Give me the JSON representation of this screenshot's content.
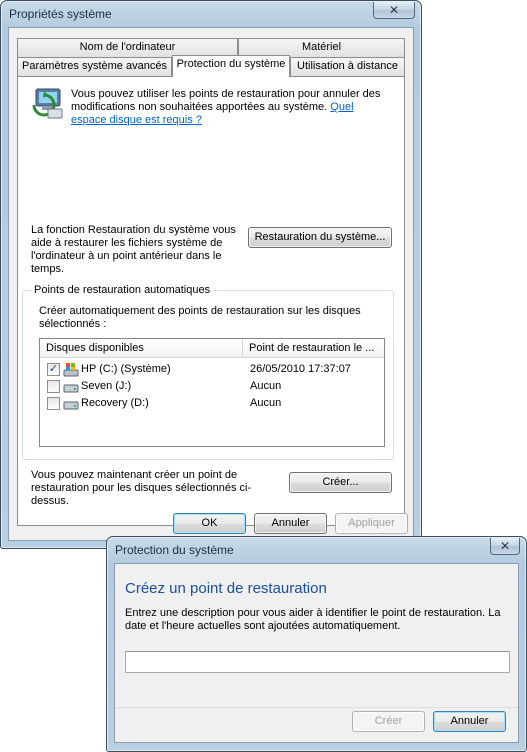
{
  "main_window": {
    "title": "Propriétés système",
    "close_glyph": "✕",
    "tabs_row1": [
      "Nom de l'ordinateur",
      "Matériel"
    ],
    "tabs_row2": [
      "Paramètres système avancés",
      "Protection du système",
      "Utilisation à distance"
    ],
    "intro_text": "Vous pouvez utiliser les points de restauration pour annuler des modifications non souhaitées apportées au système.",
    "intro_link": "Quel espace disque est requis ?",
    "restore_text": "La fonction Restauration du système vous aide à restaurer les fichiers système de l'ordinateur à un point antérieur dans le temps.",
    "restore_button": "Restauration du système...",
    "group_title": "Points de restauration automatiques",
    "group_desc": "Créer automatiquement des points de restauration sur les disques sélectionnés :",
    "list_headers": [
      "Disques disponibles",
      "Point de restauration le ..."
    ],
    "disks": [
      {
        "name": "HP (C:) (Système)",
        "point": "26/05/2010 17:37:07",
        "checked": true,
        "icon": "system-drive-icon"
      },
      {
        "name": "Seven (J:)",
        "point": "Aucun",
        "checked": false,
        "icon": "drive-icon"
      },
      {
        "name": "Recovery (D:)",
        "point": "Aucun",
        "checked": false,
        "icon": "drive-icon"
      }
    ],
    "create_text": "Vous pouvez maintenant créer un point de restauration pour les disques sélectionnés ci-dessus.",
    "create_button": "Créer...",
    "ok_button": "OK",
    "cancel_button": "Annuler",
    "apply_button": "Appliquer"
  },
  "dialog": {
    "title": "Protection du système",
    "close_glyph": "✕",
    "heading": "Créez un point de restauration",
    "description": "Entrez une description pour vous aider à identifier le point de restauration. La date et l'heure actuelles sont ajoutées automatiquement.",
    "input_value": "",
    "create_button": "Créer",
    "cancel_button": "Annuler"
  },
  "colors": {
    "link": "#0066cc",
    "heading": "#1b4fa0",
    "frame": "#b2cbe0"
  }
}
